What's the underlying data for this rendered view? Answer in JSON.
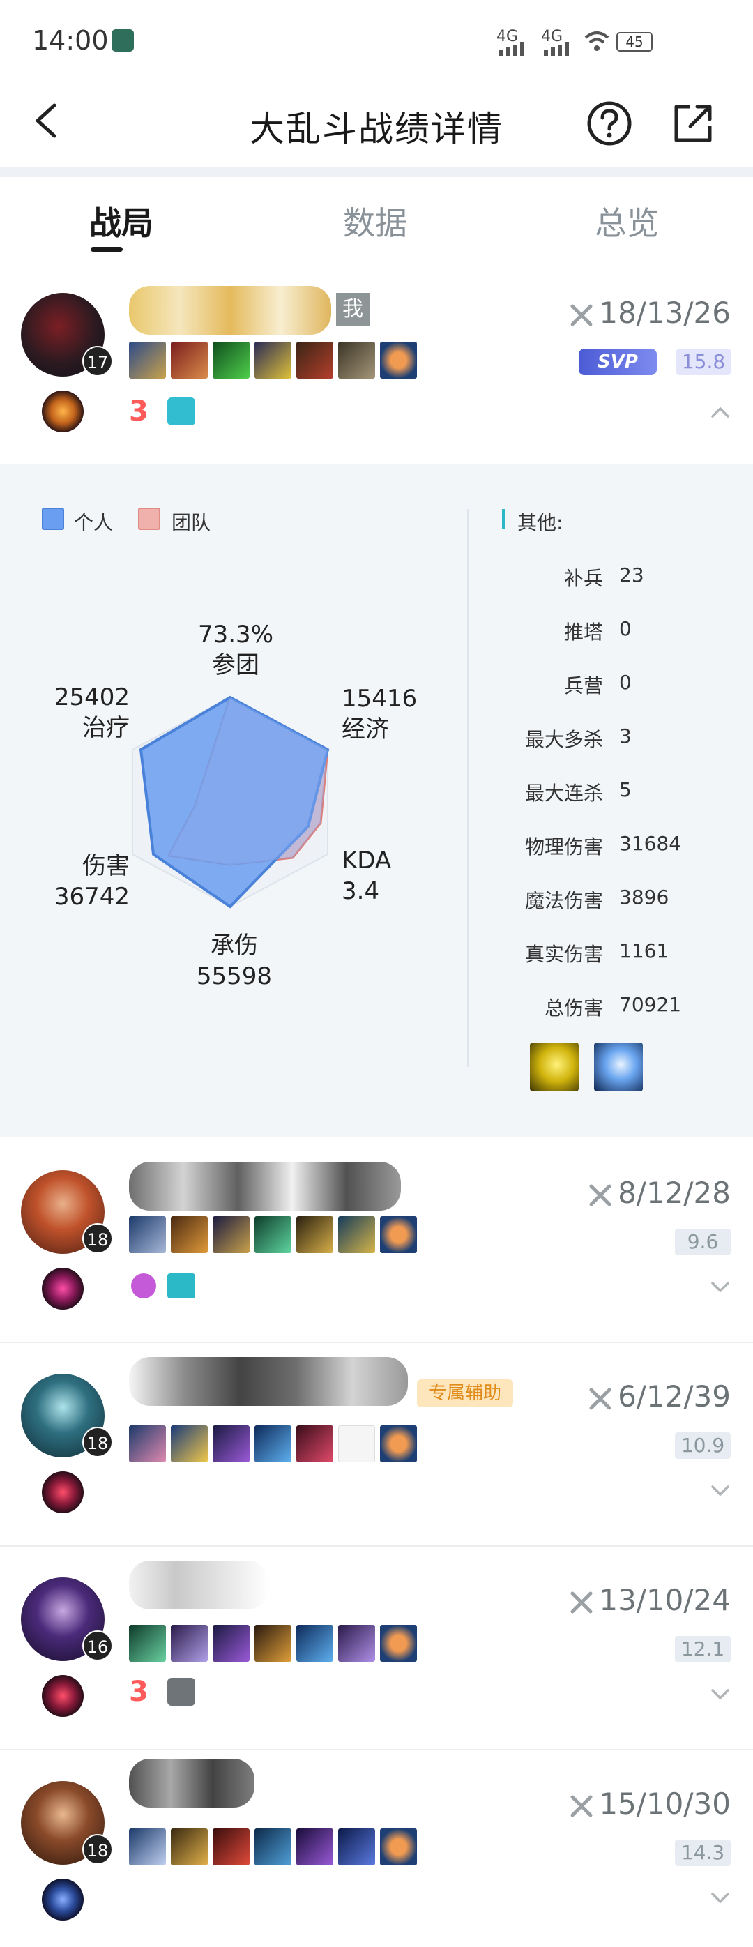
{
  "status": {
    "time": "14:00",
    "net1": "4G",
    "net2": "4G",
    "battery": "45"
  },
  "nav": {
    "title": "大乱斗战绩详情",
    "back_icon": "chevron-left-icon",
    "help_icon": "help-circle-icon",
    "share_icon": "share-external-icon"
  },
  "tabs": [
    {
      "label": "战局"
    },
    {
      "label": "数据"
    },
    {
      "label": "总览"
    }
  ],
  "colors": {
    "personal": "#6a9ef0",
    "team": "#f0b1ac",
    "mvp": "#5a6bd8",
    "accent": "#2bb8c7"
  },
  "players": [
    {
      "level": "17",
      "me_tag": "我",
      "kda": "18/13/26",
      "mvp_label": "SVP",
      "score": "15.8",
      "tags": [
        "三杀",
        "盾牌"
      ],
      "expanded": true
    },
    {
      "level": "18",
      "kda": "8/12/28",
      "score": "9.6",
      "expanded": false
    },
    {
      "level": "18",
      "tag": "专属辅助",
      "kda": "6/12/39",
      "score": "10.9",
      "expanded": false
    },
    {
      "level": "16",
      "kda": "13/10/24",
      "score": "12.1",
      "expanded": false
    },
    {
      "level": "18",
      "kda": "15/10/30",
      "score": "14.3",
      "expanded": false
    }
  ],
  "radar": {
    "legend": {
      "personal": "个人",
      "team": "团队"
    },
    "participation": {
      "value": "73.3%",
      "label": "参团"
    },
    "economy": {
      "value": "15416",
      "label": "经济"
    },
    "kda": {
      "label": "KDA",
      "value": "3.4"
    },
    "tanked": {
      "label": "承伤",
      "value": "55598"
    },
    "damage": {
      "label": "伤害",
      "value": "36742"
    },
    "healing": {
      "value": "25402",
      "label": "治疗"
    }
  },
  "other": {
    "title": "其他:",
    "stats": [
      {
        "label": "补兵",
        "value": "23"
      },
      {
        "label": "推塔",
        "value": "0"
      },
      {
        "label": "兵营",
        "value": "0"
      },
      {
        "label": "最大多杀",
        "value": "3"
      },
      {
        "label": "最大连杀",
        "value": "5"
      },
      {
        "label": "物理伤害",
        "value": "31684"
      },
      {
        "label": "魔法伤害",
        "value": "3896"
      },
      {
        "label": "真实伤害",
        "value": "1161"
      },
      {
        "label": "总伤害",
        "value": "70921"
      }
    ]
  }
}
